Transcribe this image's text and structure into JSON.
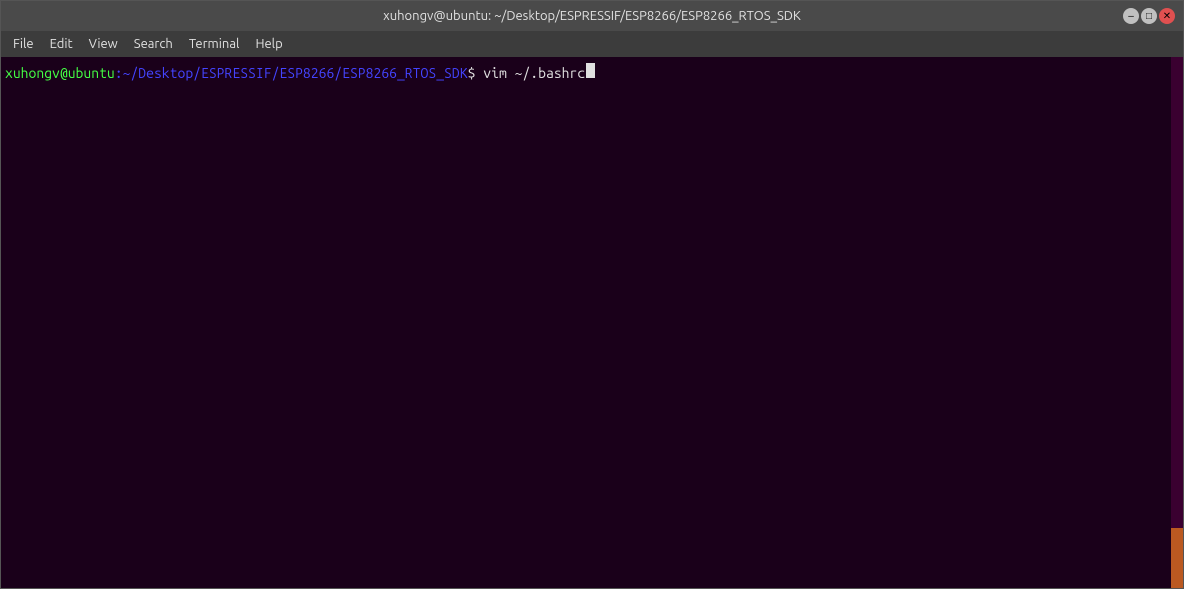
{
  "titleBar": {
    "title": "xuhongv@ubuntu: ~/Desktop/ESPRESSIF/ESP8266/ESP8266_RTOS_SDK"
  },
  "windowControls": {
    "minimize": "–",
    "maximize": "□",
    "close": "✕"
  },
  "menuBar": {
    "items": [
      {
        "label": "File"
      },
      {
        "label": "Edit"
      },
      {
        "label": "View"
      },
      {
        "label": "Search"
      },
      {
        "label": "Terminal"
      },
      {
        "label": "Help"
      }
    ]
  },
  "terminal": {
    "promptUser": "xuhongv@ubuntu",
    "promptPath": ":~/Desktop/ESPRESSIF/ESP8266/ESP8266_RTOS_SDK",
    "promptDollar": "$",
    "command": " vim ~/.bashrc"
  }
}
